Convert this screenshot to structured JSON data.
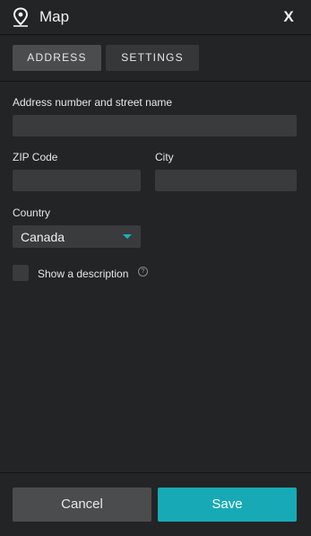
{
  "header": {
    "icon": "map-pin-icon",
    "title": "Map",
    "close_label": "X"
  },
  "tabs": [
    {
      "label": "ADDRESS",
      "active": true
    },
    {
      "label": "SETTINGS",
      "active": false
    }
  ],
  "form": {
    "street": {
      "label": "Address number and street name",
      "value": "",
      "placeholder": ""
    },
    "zip": {
      "label": "ZIP Code",
      "value": "",
      "placeholder": ""
    },
    "city": {
      "label": "City",
      "value": "",
      "placeholder": ""
    },
    "country": {
      "label": "Country",
      "selected": "Canada",
      "caret_icon": "caret-down-icon"
    },
    "description": {
      "label": "Show a description",
      "checked": false,
      "help_icon": "question-circle-icon"
    }
  },
  "footer": {
    "cancel_label": "Cancel",
    "save_label": "Save"
  },
  "colors": {
    "background": "#232425",
    "field": "#3a3b3c",
    "tab_active": "#4b4c4e",
    "tab_inactive": "#363738",
    "accent": "#17aab6"
  }
}
